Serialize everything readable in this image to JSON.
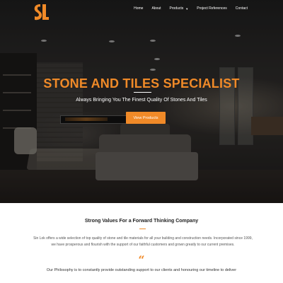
{
  "brand": {
    "accent_color": "#f08a28",
    "logo_icon": "sl-logo-icon"
  },
  "nav": {
    "items": [
      {
        "label": "Home"
      },
      {
        "label": "About"
      },
      {
        "label": "Products",
        "has_dropdown": true
      },
      {
        "label": "Project References"
      },
      {
        "label": "Contact"
      }
    ]
  },
  "hero": {
    "title": "STONE AND TILES SPECIALIST",
    "subtitle": "Always Bringing You The Finest Quality Of Stones And Tiles",
    "button_label": "View Products"
  },
  "values": {
    "title": "Strong Values For a Forward Thinking Company",
    "text": "Sin Lok offers a wide selection of top quality of stone and tile materials for all your building and construction needs. Incorporated since 1999, we have prosperous and flourish with the support of our faithful customers and grown greatly to our current premises."
  },
  "quote": {
    "icon": "quote-icon",
    "glyph": "“",
    "text": "Our Philosophy is to constantly provide outstanding support to our clients and honouring our timeline to deliver"
  }
}
